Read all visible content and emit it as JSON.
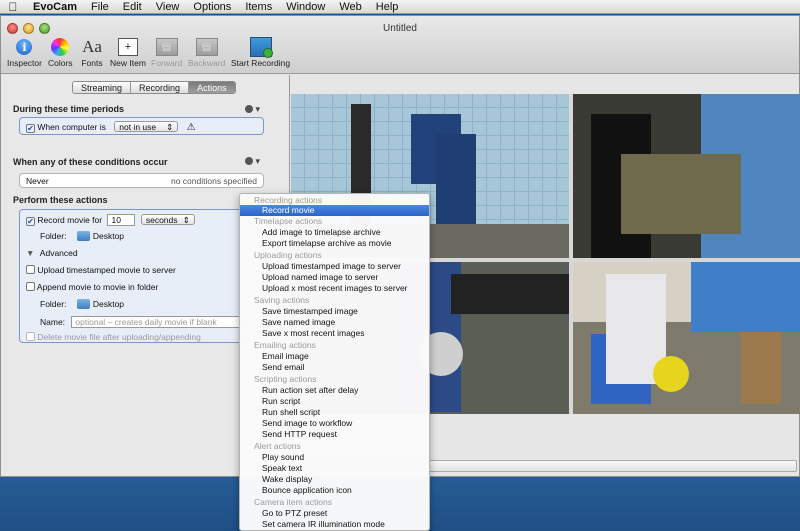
{
  "menubar": {
    "app": "EvoCam",
    "items": [
      "File",
      "Edit",
      "View",
      "Options",
      "Items",
      "Window",
      "Web",
      "Help"
    ]
  },
  "window": {
    "title": "Untitled"
  },
  "toolbar": {
    "inspector": "Inspector",
    "colors": "Colors",
    "fonts": "Fonts",
    "fonts_glyph": "Aa",
    "new_item": "New Item",
    "forward": "Forward",
    "backward": "Backward",
    "start_recording": "Start Recording"
  },
  "tabs": [
    "Streaming",
    "Recording",
    "Actions"
  ],
  "active_tab": "Actions",
  "time_periods": {
    "heading": "During these time periods",
    "condition_label": "When computer is",
    "condition_value": "not in use",
    "warning_glyph": "⚠"
  },
  "conditions": {
    "heading": "When any of these conditions occur",
    "left": "Never",
    "right": "no conditions specified"
  },
  "actions": {
    "heading": "Perform these actions",
    "record_label": "Record movie for",
    "record_value": "10",
    "record_unit": "seconds",
    "folder_label": "Folder:",
    "folder_value": "Desktop",
    "advanced": "Advanced",
    "upload_label": "Upload timestamped movie to server",
    "append_label": "Append movie to movie in folder",
    "folder2_label": "Folder:",
    "folder2_value": "Desktop",
    "name_label": "Name:",
    "name_placeholder": "optional – creates daily movie if blank",
    "delete_label": "Delete movie file after uploading/appending"
  },
  "dropdown": {
    "selected": "Record movie",
    "groups": [
      {
        "header": "Recording actions",
        "items": [
          "Record movie"
        ]
      },
      {
        "header": "Timelapse actions",
        "items": [
          "Add image to timelapse archive",
          "Export timelapse archive as movie"
        ]
      },
      {
        "header": "Uploading actions",
        "items": [
          "Upload timestamped image to server",
          "Upload named image to server",
          "Upload x most recent images to server"
        ]
      },
      {
        "header": "Saving actions",
        "items": [
          "Save timestamped image",
          "Save named image",
          "Save x most recent images"
        ]
      },
      {
        "header": "Emailing actions",
        "items": [
          "Email image",
          "Send email"
        ]
      },
      {
        "header": "Scripting actions",
        "items": [
          "Run action set after delay",
          "Run script",
          "Run shell script",
          "Send image to workflow",
          "Send HTTP request"
        ]
      },
      {
        "header": "Alert actions",
        "items": [
          "Play sound",
          "Speak text",
          "Wake display",
          "Bounce application icon"
        ]
      },
      {
        "header": "Camera item actions",
        "items": [
          "Go to PTZ preset",
          "Set camera IR illumination mode"
        ]
      }
    ]
  }
}
